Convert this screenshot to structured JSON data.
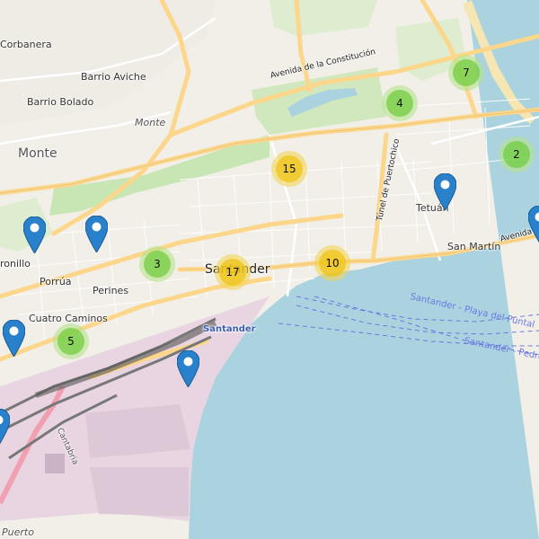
{
  "map": {
    "colors": {
      "water": "#aad3df",
      "land": "#f2efe9",
      "park": "#c8e6b4",
      "port": "#e9d4e2",
      "major_road": "#fcd68a",
      "rail": "#8a8a8a",
      "marker_blue": "#2a81cb",
      "cluster_green": "#6ecc39",
      "cluster_yellow": "#f0c20c",
      "ferry_line": "#6b78e0"
    },
    "labels": {
      "corbanera": "Corbanera",
      "barrio_aviche": "Barrio Aviche",
      "barrio_bolado": "Barrio Bolado",
      "monte_area": "Monte",
      "monte": "Monte",
      "avenida_constitucion": "Avenida de la Constitución",
      "tunel_puertochico": "Túnel de Puertochico",
      "tetuan": "Tetuán",
      "san_martin": "San Martín",
      "avenida_right": "Avenida de",
      "santander": "Santander",
      "porrua": "Porrúa",
      "perines": "Perines",
      "cuatro_caminos": "Cuatro Caminos",
      "cazona": "ronillo",
      "santander_station": "Santander",
      "cantabria": "Cantabria",
      "puerto": "Puerto",
      "ferry_1": "Santander - Playa del Puntal",
      "ferry_2": "Santander - Pedre"
    },
    "clusters": [
      {
        "name": "cluster-7",
        "count": "7",
        "color": "green"
      },
      {
        "name": "cluster-4",
        "count": "4",
        "color": "green"
      },
      {
        "name": "cluster-2",
        "count": "2",
        "color": "green"
      },
      {
        "name": "cluster-15",
        "count": "15",
        "color": "yellow"
      },
      {
        "name": "cluster-17",
        "count": "17",
        "color": "yellow"
      },
      {
        "name": "cluster-10",
        "count": "10",
        "color": "yellow"
      },
      {
        "name": "cluster-3",
        "count": "3",
        "color": "green"
      },
      {
        "name": "cluster-5",
        "count": "5",
        "color": "green"
      }
    ],
    "markers": [
      "marker-tetuan",
      "marker-east-edge",
      "marker-west-1",
      "marker-west-2",
      "marker-cuatro-caminos",
      "marker-port",
      "marker-southwest-edge"
    ]
  }
}
